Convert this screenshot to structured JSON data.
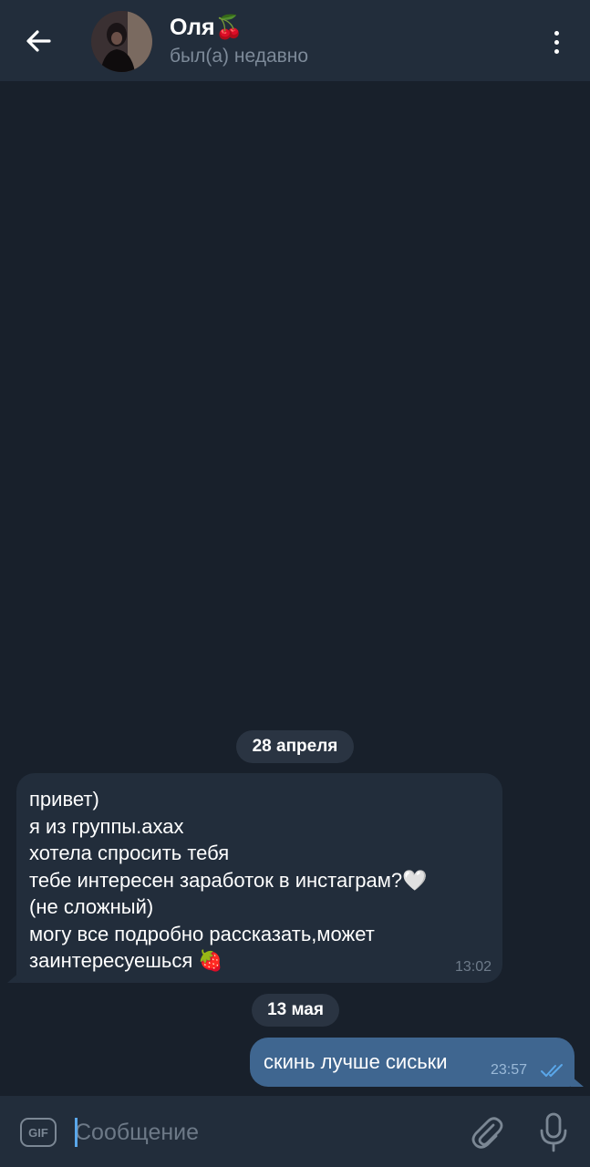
{
  "header": {
    "title": "Оля🍒",
    "status": "был(а) недавно"
  },
  "messages": {
    "date_1": "28 апреля",
    "incoming": {
      "text": "привет)\nя из группы.ахах\nхотела спросить тебя\nтебе интересен заработок в инстаграм?🤍\n(не сложный)\nмогу все подробно рассказать,может заинтересуешься 🍓",
      "time": "13:02"
    },
    "date_2": "13 мая",
    "outgoing": {
      "text": "скинь лучше сиськи",
      "time": "23:57"
    }
  },
  "composer": {
    "gif_label": "GIF",
    "placeholder": "Сообщение"
  },
  "colors": {
    "background": "#18202b",
    "header": "#222d3b",
    "incoming_bubble": "#222d3b",
    "outgoing_bubble": "#3f6690",
    "date_chip": "#2a3442",
    "read_checks": "#5aa7ea"
  },
  "icons": {
    "back": "arrow-left-icon",
    "more": "more-vertical-icon",
    "attach": "paperclip-icon",
    "mic": "microphone-icon",
    "read": "double-check-icon"
  }
}
